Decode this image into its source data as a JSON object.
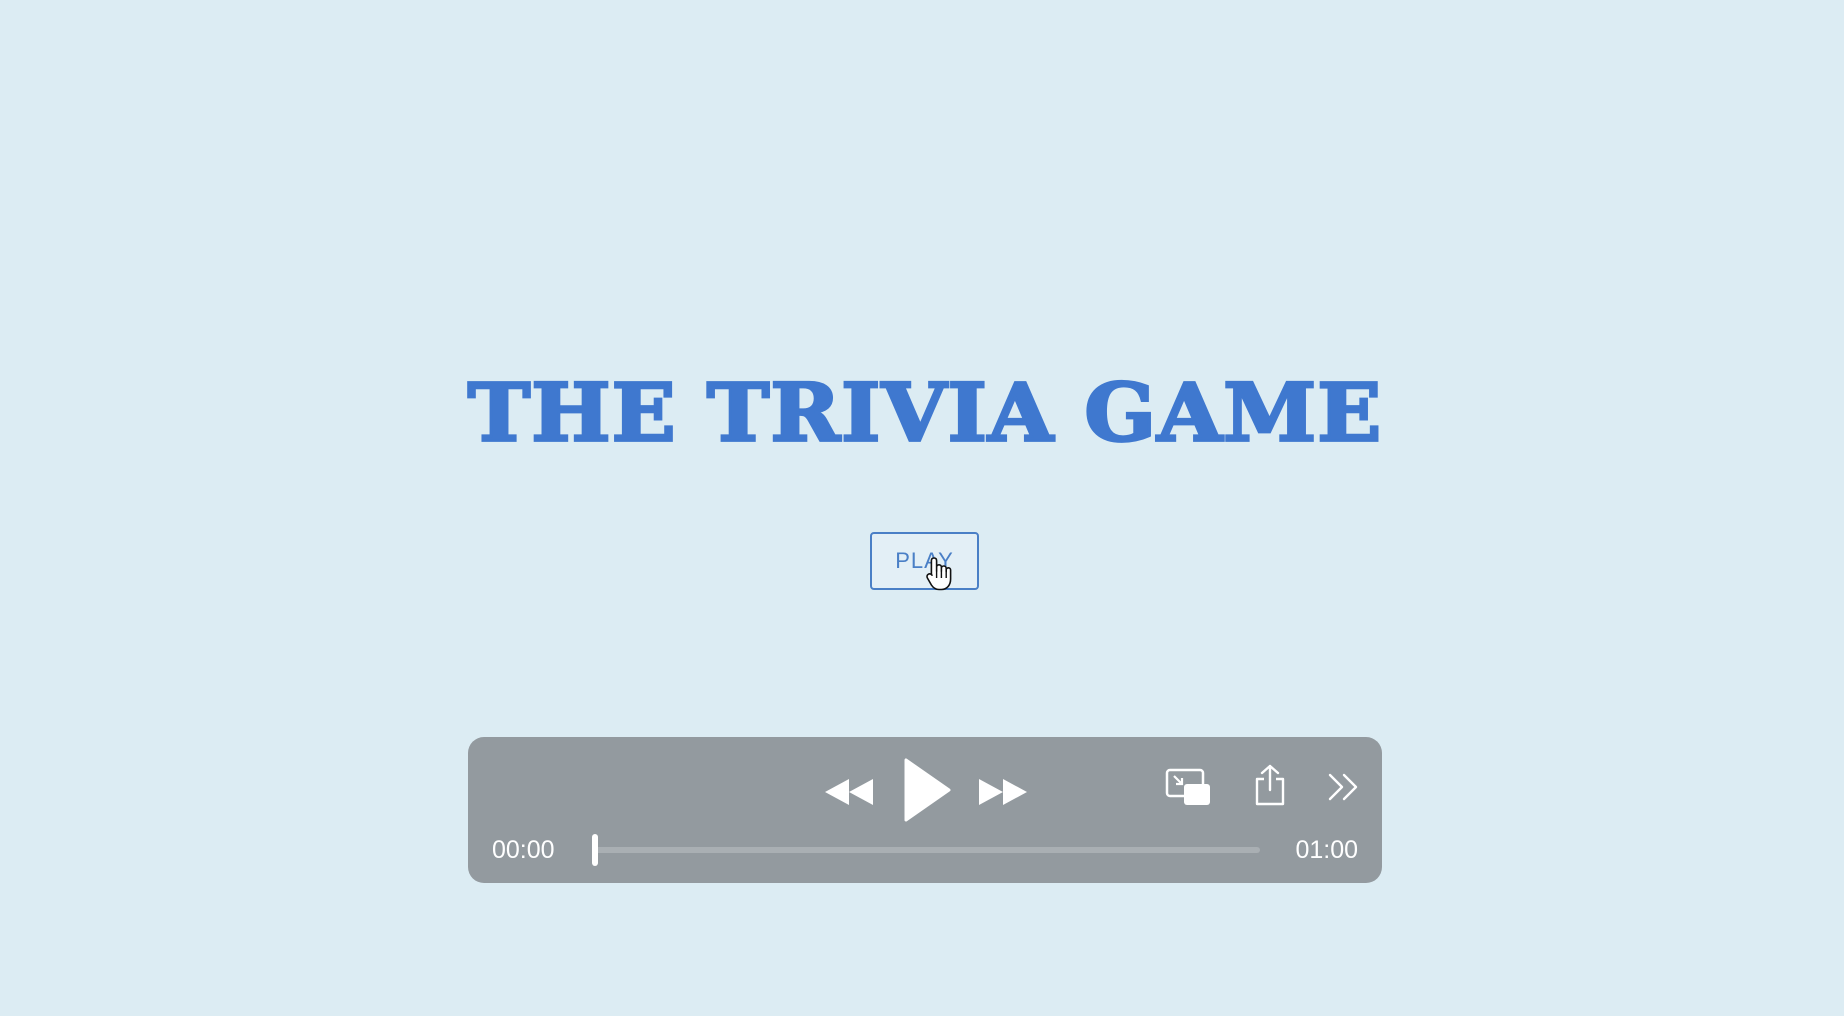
{
  "page": {
    "title": "THE TRIVIA GAME",
    "play_button_label": "PLAY"
  },
  "colors": {
    "background": "#dcecf3",
    "title": "#3f78cf",
    "button_border": "#4a7fc6",
    "player_bar": "#939a9f",
    "player_controls": "#ffffff"
  },
  "media_player": {
    "current_time": "00:00",
    "total_time": "01:00",
    "progress": 0,
    "controls": [
      "rewind-icon",
      "play-icon",
      "fast-forward-icon",
      "picture-in-picture-icon",
      "share-icon",
      "more-icon"
    ]
  },
  "cursor": {
    "type": "hand-pointer",
    "over": "play-button"
  }
}
